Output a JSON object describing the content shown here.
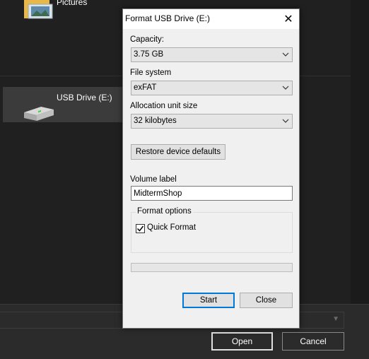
{
  "background": {
    "folder_label": "Pictures",
    "drive_label": "USB Drive (E:)",
    "open_button": "Open",
    "cancel_button": "Cancel"
  },
  "dialog": {
    "title": "Format USB Drive (E:)",
    "capacity": {
      "label": "Capacity:",
      "value": "3.75 GB"
    },
    "file_system": {
      "label": "File system",
      "value": "exFAT"
    },
    "allocation": {
      "label": "Allocation unit size",
      "value": "32 kilobytes"
    },
    "restore_button": "Restore device defaults",
    "volume_label": {
      "label": "Volume label",
      "value": "MidtermShop"
    },
    "format_options": {
      "legend": "Format options",
      "quick_format_label": "Quick Format",
      "quick_format_checked": true
    },
    "progress": 0,
    "start_button": "Start",
    "close_button": "Close"
  },
  "colors": {
    "accent": "#0078d7",
    "dialog_bg": "#f0f0f0",
    "dark_bg": "#202020"
  }
}
